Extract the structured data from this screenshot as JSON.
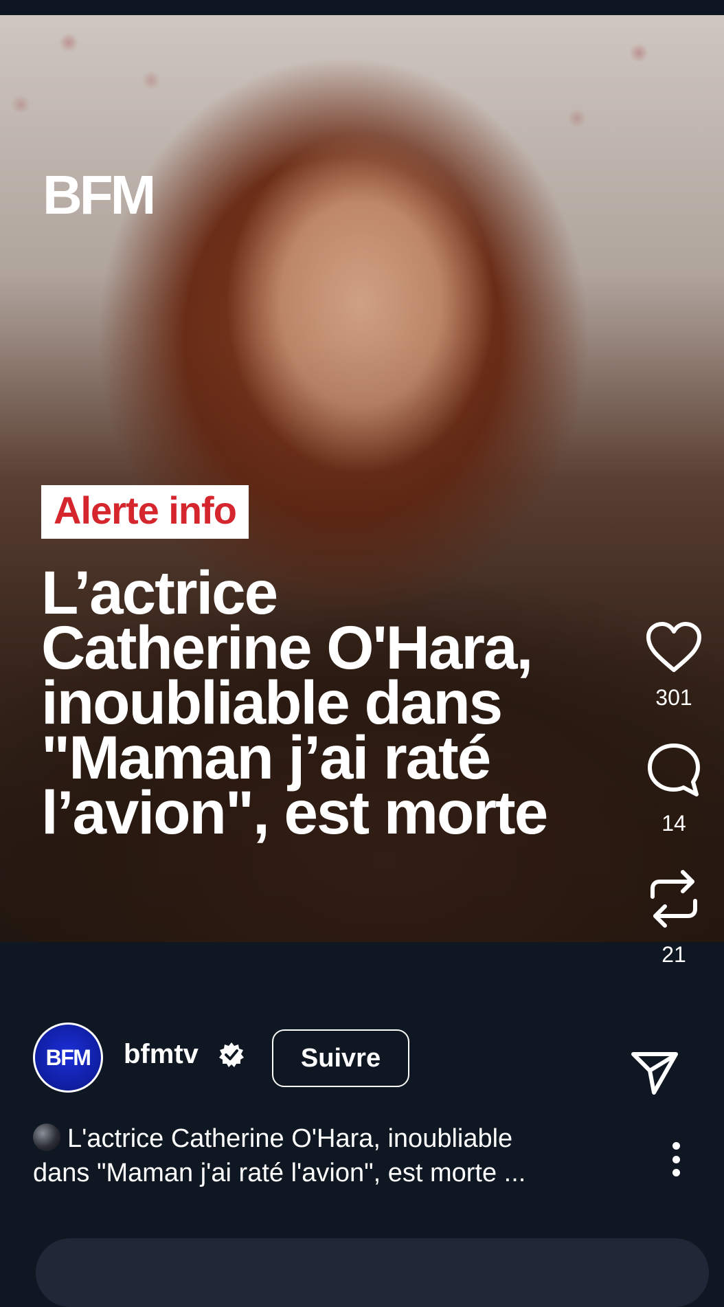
{
  "post": {
    "logo": "BFM",
    "alert_label": "Alerte info",
    "headline_lines": [
      "L’actrice",
      "Catherine O'Hara,",
      "inoubliable dans",
      "\"Maman j’ai raté",
      "l’avion\", est morte"
    ]
  },
  "actions": {
    "likes": "301",
    "comments": "14",
    "reposts": "21"
  },
  "author": {
    "avatar_text": "BFM",
    "username": "bfmtv",
    "follow_label": "Suivre"
  },
  "caption": {
    "line1": "L'actrice Catherine O'Hara, inoubliable",
    "line2": "dans \"Maman j'ai raté l'avion\", est morte ..."
  },
  "icons": {
    "like": "heart-icon",
    "comment": "comment-bubble-icon",
    "repost": "repost-icon",
    "share": "paper-plane-icon",
    "verified": "verified-badge-icon",
    "more": "more-vertical-icon"
  },
  "colors": {
    "background": "#0f1722",
    "alert_red": "#d4262c",
    "avatar_blue": "#1b2fd8"
  }
}
